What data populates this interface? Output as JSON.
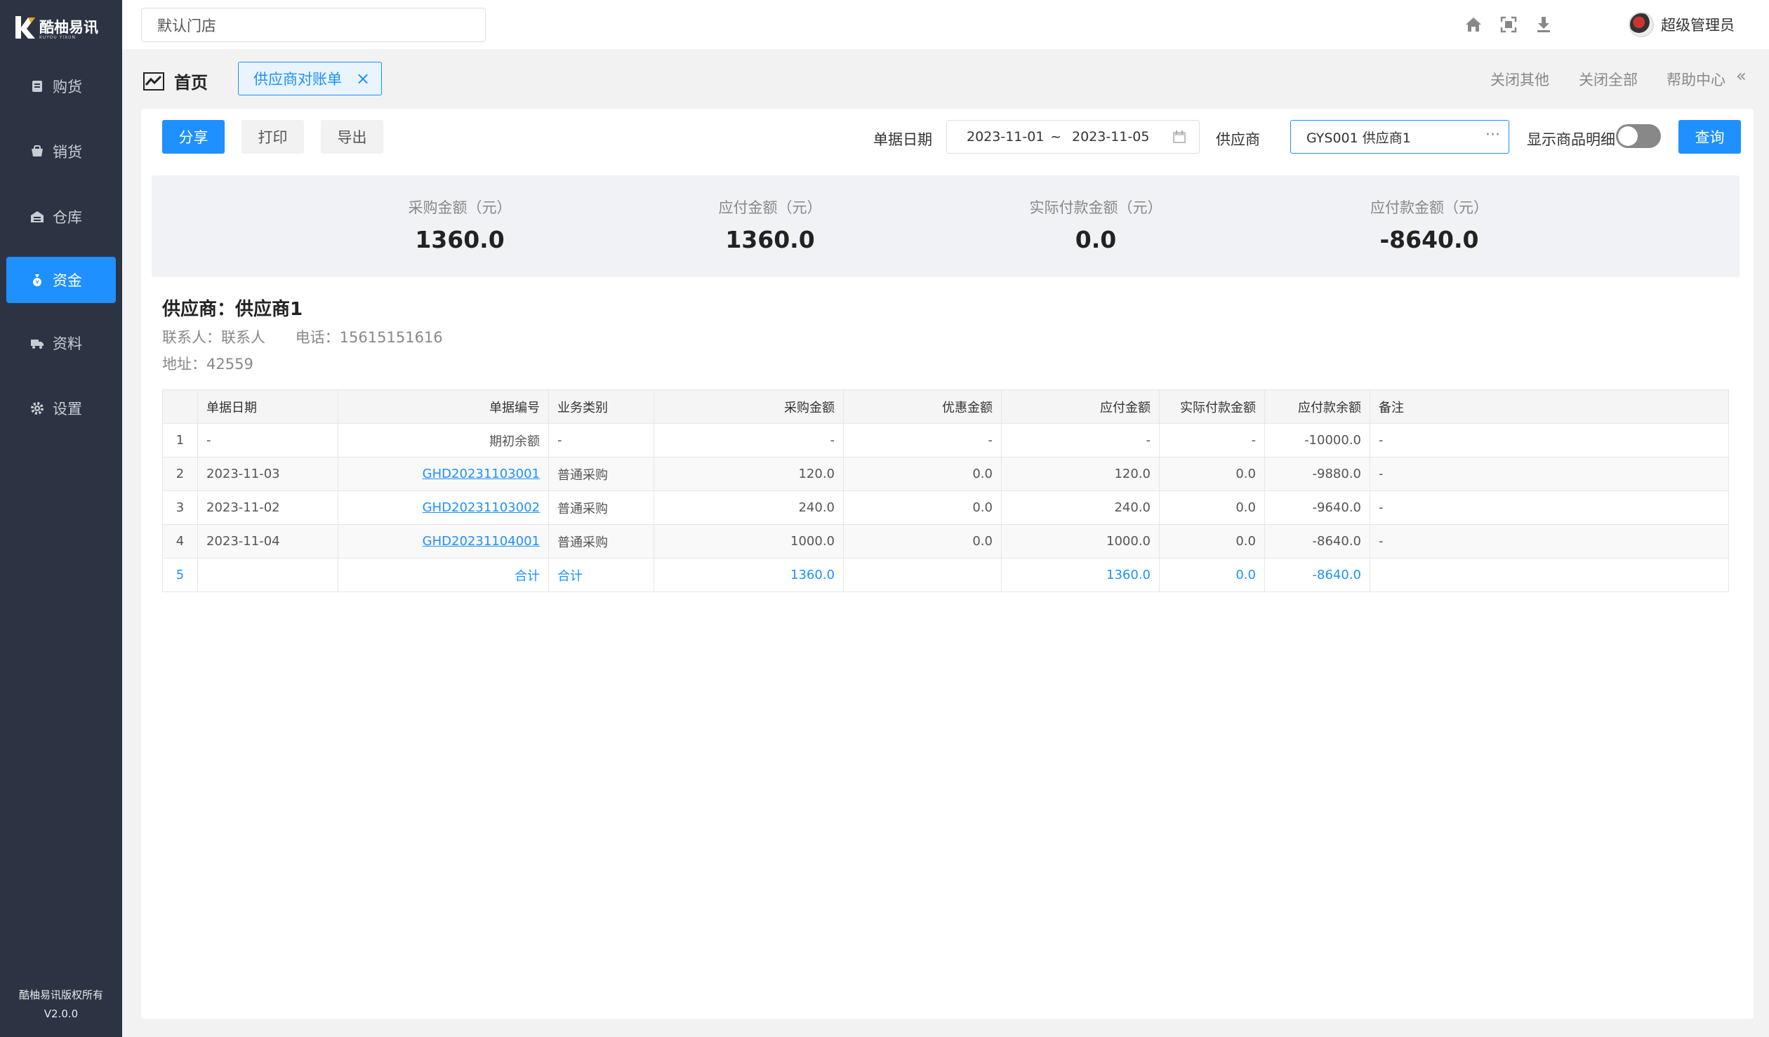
{
  "sidebar": {
    "logo_text": "酷柚易讯",
    "logo_sub": "KUYOU YIXUN",
    "items": [
      {
        "label": "购货",
        "icon": "purchase-icon"
      },
      {
        "label": "销货",
        "icon": "sales-icon"
      },
      {
        "label": "仓库",
        "icon": "warehouse-icon"
      },
      {
        "label": "资金",
        "icon": "money-bag-icon",
        "active": true
      },
      {
        "label": "资料",
        "icon": "truck-icon"
      },
      {
        "label": "设置",
        "icon": "gear-icon"
      }
    ],
    "copyright": "酷柚易讯版权所有",
    "version": "V2.0.0"
  },
  "topbar": {
    "store_value": "默认门店",
    "icons": [
      "home-icon",
      "fullscreen-icon",
      "download-icon"
    ],
    "user_name": "超级管理员"
  },
  "tabs": {
    "home_label": "首页",
    "active_tab_label": "供应商对账单",
    "close_others": "关闭其他",
    "close_all": "关闭全部",
    "help": "帮助中心",
    "collapse": "«"
  },
  "toolbar": {
    "share": "分享",
    "print": "打印",
    "export": "导出",
    "date_label": "单据日期",
    "date_from": "2023-11-01",
    "date_sep": "~",
    "date_to": "2023-11-05",
    "supplier_label": "供应商",
    "supplier_value": "GYS001 供应商1",
    "show_detail_label": "显示商品明细",
    "show_detail_on": false,
    "query": "查询"
  },
  "summary": [
    {
      "label": "采购金额（元）",
      "value": "1360.0"
    },
    {
      "label": "应付金额（元）",
      "value": "1360.0"
    },
    {
      "label": "实际付款金额（元）",
      "value": "0.0"
    },
    {
      "label": "应付款金额（元）",
      "value": "-8640.0"
    }
  ],
  "supplier": {
    "title": "供应商：供应商1",
    "contact": "联系人：联系人",
    "phone": "电话：15615151616",
    "address": "地址：42559"
  },
  "table": {
    "headers": [
      "",
      "单据日期",
      "单据编号",
      "业务类别",
      "采购金额",
      "优惠金额",
      "应付金额",
      "实际付款金额",
      "应付款余额",
      "备注"
    ],
    "rows": [
      [
        "1",
        "-",
        "期初余额",
        "-",
        "-",
        "-",
        "-",
        "-",
        "-10000.0",
        "-"
      ],
      [
        "2",
        "2023-11-03",
        "GHD20231103001",
        "普通采购",
        "120.0",
        "0.0",
        "120.0",
        "0.0",
        "-9880.0",
        "-"
      ],
      [
        "3",
        "2023-11-02",
        "GHD20231103002",
        "普通采购",
        "240.0",
        "0.0",
        "240.0",
        "0.0",
        "-9640.0",
        "-"
      ],
      [
        "4",
        "2023-11-04",
        "GHD20231104001",
        "普通采购",
        "1000.0",
        "0.0",
        "1000.0",
        "0.0",
        "-8640.0",
        "-"
      ],
      [
        "5",
        "",
        "合计",
        "合计",
        "1360.0",
        "",
        "1360.0",
        "0.0",
        "-8640.0",
        ""
      ]
    ]
  },
  "colors": {
    "accent": "#1e90ff",
    "sidebar_bg": "#2c3443"
  }
}
